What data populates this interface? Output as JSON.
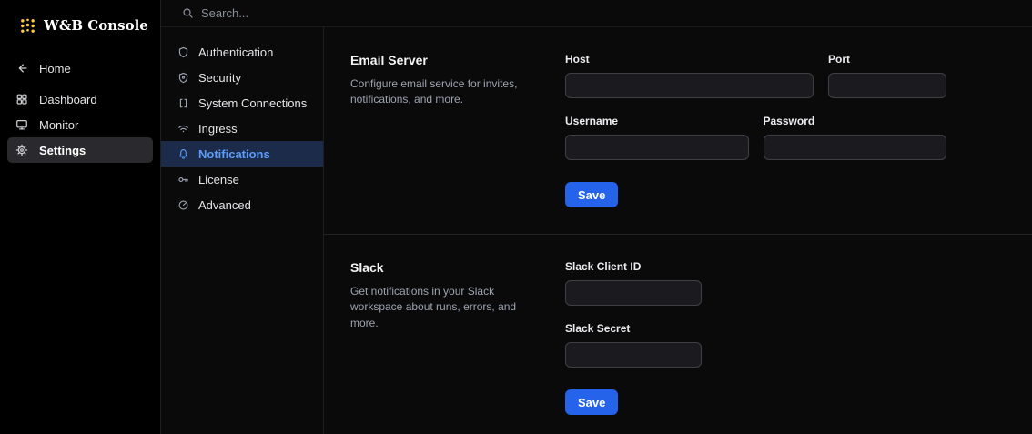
{
  "app": {
    "title": "W&B Console"
  },
  "topbar": {
    "search_placeholder": "Search..."
  },
  "sidebar": {
    "items": [
      {
        "label": "Home",
        "icon": "arrow-left-icon"
      },
      {
        "label": "Dashboard",
        "icon": "grid-icon"
      },
      {
        "label": "Monitor",
        "icon": "monitor-icon"
      },
      {
        "label": "Settings",
        "icon": "gear-icon",
        "active": true
      }
    ]
  },
  "settings_nav": {
    "items": [
      {
        "label": "Authentication",
        "icon": "shield-icon"
      },
      {
        "label": "Security",
        "icon": "shield-icon"
      },
      {
        "label": "System Connections",
        "icon": "brackets-icon"
      },
      {
        "label": "Ingress",
        "icon": "wifi-icon"
      },
      {
        "label": "Notifications",
        "icon": "bell-icon",
        "active": true
      },
      {
        "label": "License",
        "icon": "key-icon"
      },
      {
        "label": "Advanced",
        "icon": "gauge-icon"
      }
    ]
  },
  "sections": [
    {
      "title": "Email Server",
      "description": "Configure email service for invites, notifications, and more.",
      "fields": [
        {
          "label": "Host",
          "value": ""
        },
        {
          "label": "Port",
          "value": ""
        },
        {
          "label": "Username",
          "value": ""
        },
        {
          "label": "Password",
          "value": ""
        }
      ],
      "save_label": "Save"
    },
    {
      "title": "Slack",
      "description": "Get notifications in your Slack workspace about runs, errors, and more.",
      "fields": [
        {
          "label": "Slack Client ID",
          "value": ""
        },
        {
          "label": "Slack Secret",
          "value": ""
        }
      ],
      "save_label": "Save"
    }
  ],
  "colors": {
    "accent_blue": "#2563eb",
    "active_link_blue": "#5a9cf8",
    "logo_gold": "#ffcc33"
  }
}
